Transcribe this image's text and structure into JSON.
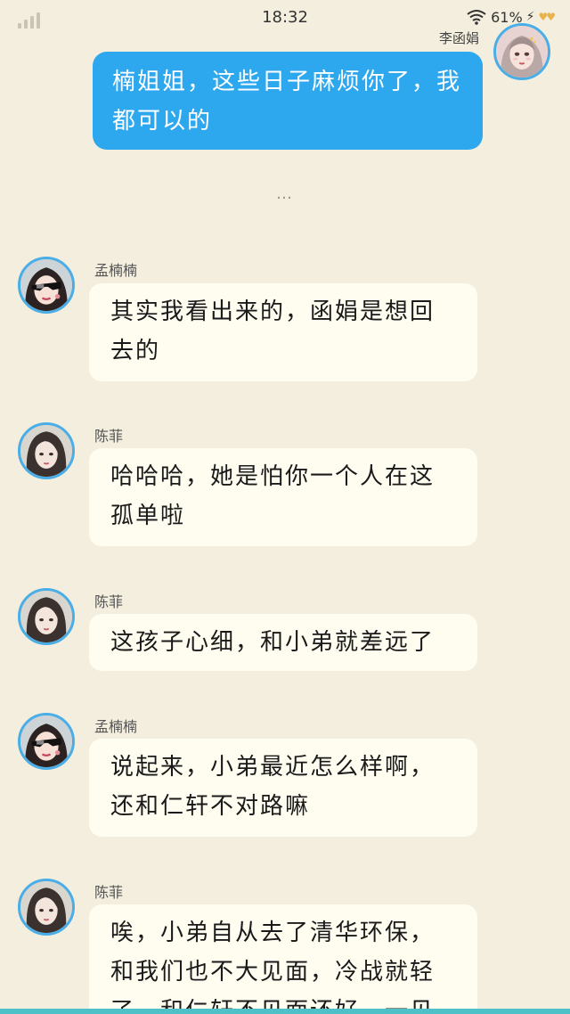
{
  "status": {
    "time": "18:32",
    "battery": "61%"
  },
  "self": {
    "name": "李函娟",
    "message": "楠姐姐，这些日子麻烦你了，我都可以的"
  },
  "separator": "…",
  "messages": [
    {
      "sender": "孟楠楠",
      "text": "其实我看出来的，函娟是想回去的",
      "avatar": "sunglasses-girl"
    },
    {
      "sender": "陈菲",
      "text": "哈哈哈，她是怕你一个人在这孤单啦",
      "avatar": "long-hair-girl"
    },
    {
      "sender": "陈菲",
      "text": "这孩子心细，和小弟就差远了",
      "avatar": "long-hair-girl"
    },
    {
      "sender": "孟楠楠",
      "text": "说起来，小弟最近怎么样啊，还和仁轩不对路嘛",
      "avatar": "sunglasses-girl"
    },
    {
      "sender": "陈菲",
      "text": "唉，小弟自从去了清华环保，和我们也不大见面，冷战就轻了，和仁轩不见面还好，一见",
      "avatar": "long-hair-girl"
    }
  ],
  "colors": {
    "sent_bubble": "#2da7ee",
    "received_bubble": "#fffcf0",
    "background": "#f3eedd",
    "avatar_border": "#49aee7"
  }
}
